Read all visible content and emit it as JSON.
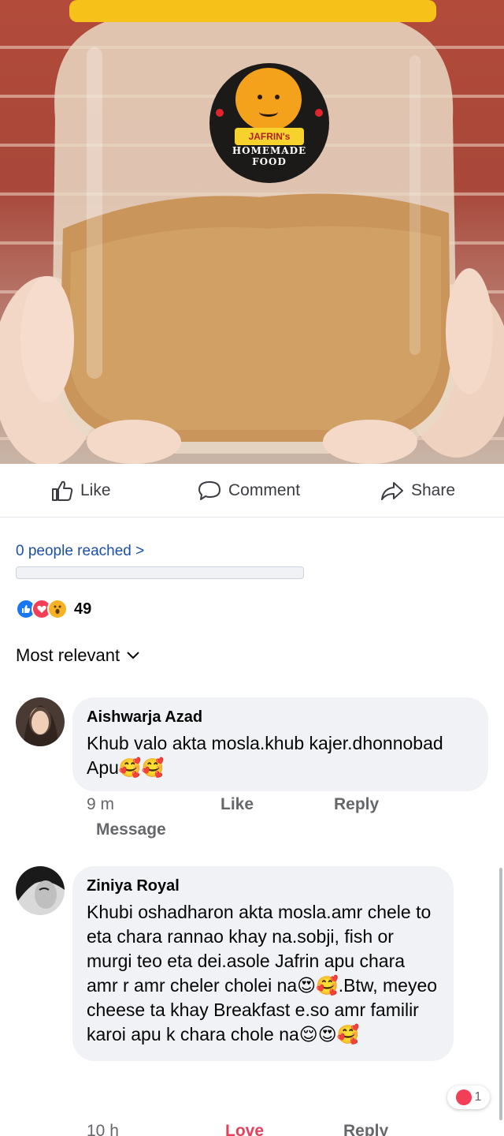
{
  "post": {
    "logo": {
      "top_text": "JAFRIN's",
      "ring_text": "HOMEMADE FOOD"
    }
  },
  "actions": {
    "like": "Like",
    "comment": "Comment",
    "share": "Share"
  },
  "insights": {
    "reached": "0 people reached >"
  },
  "reactions": {
    "icons": [
      "like-icon",
      "love-icon",
      "wow-icon"
    ],
    "count": "49"
  },
  "sort": {
    "label": "Most relevant"
  },
  "comments": [
    {
      "author": "Aishwarja Azad",
      "text": "Khub valo akta mosla.khub kajer.dhonnobad Apu🥰🥰",
      "time": "9 m",
      "like": "Like",
      "reply": "Reply",
      "message": "Message"
    },
    {
      "author": "Ziniya Royal",
      "text": "Khubi oshadharon akta mosla.amr chele to eta chara rannao khay na.sobji, fish or murgi teo eta dei.asole Jafrin apu chara amr r amr cheler cholei na😍🥰.Btw, meyeo cheese ta khay Breakfast e.so amr familir karoi apu k chara chole na😌😍🥰",
      "time": "10 h",
      "love": "Love",
      "reply": "Reply",
      "reaction_count": "1"
    }
  ],
  "colors": {
    "link": "#1b4fa8",
    "like": "#1877f2",
    "love": "#f33e58",
    "wow": "#f7b125",
    "bubble": "#f0f2f5"
  }
}
